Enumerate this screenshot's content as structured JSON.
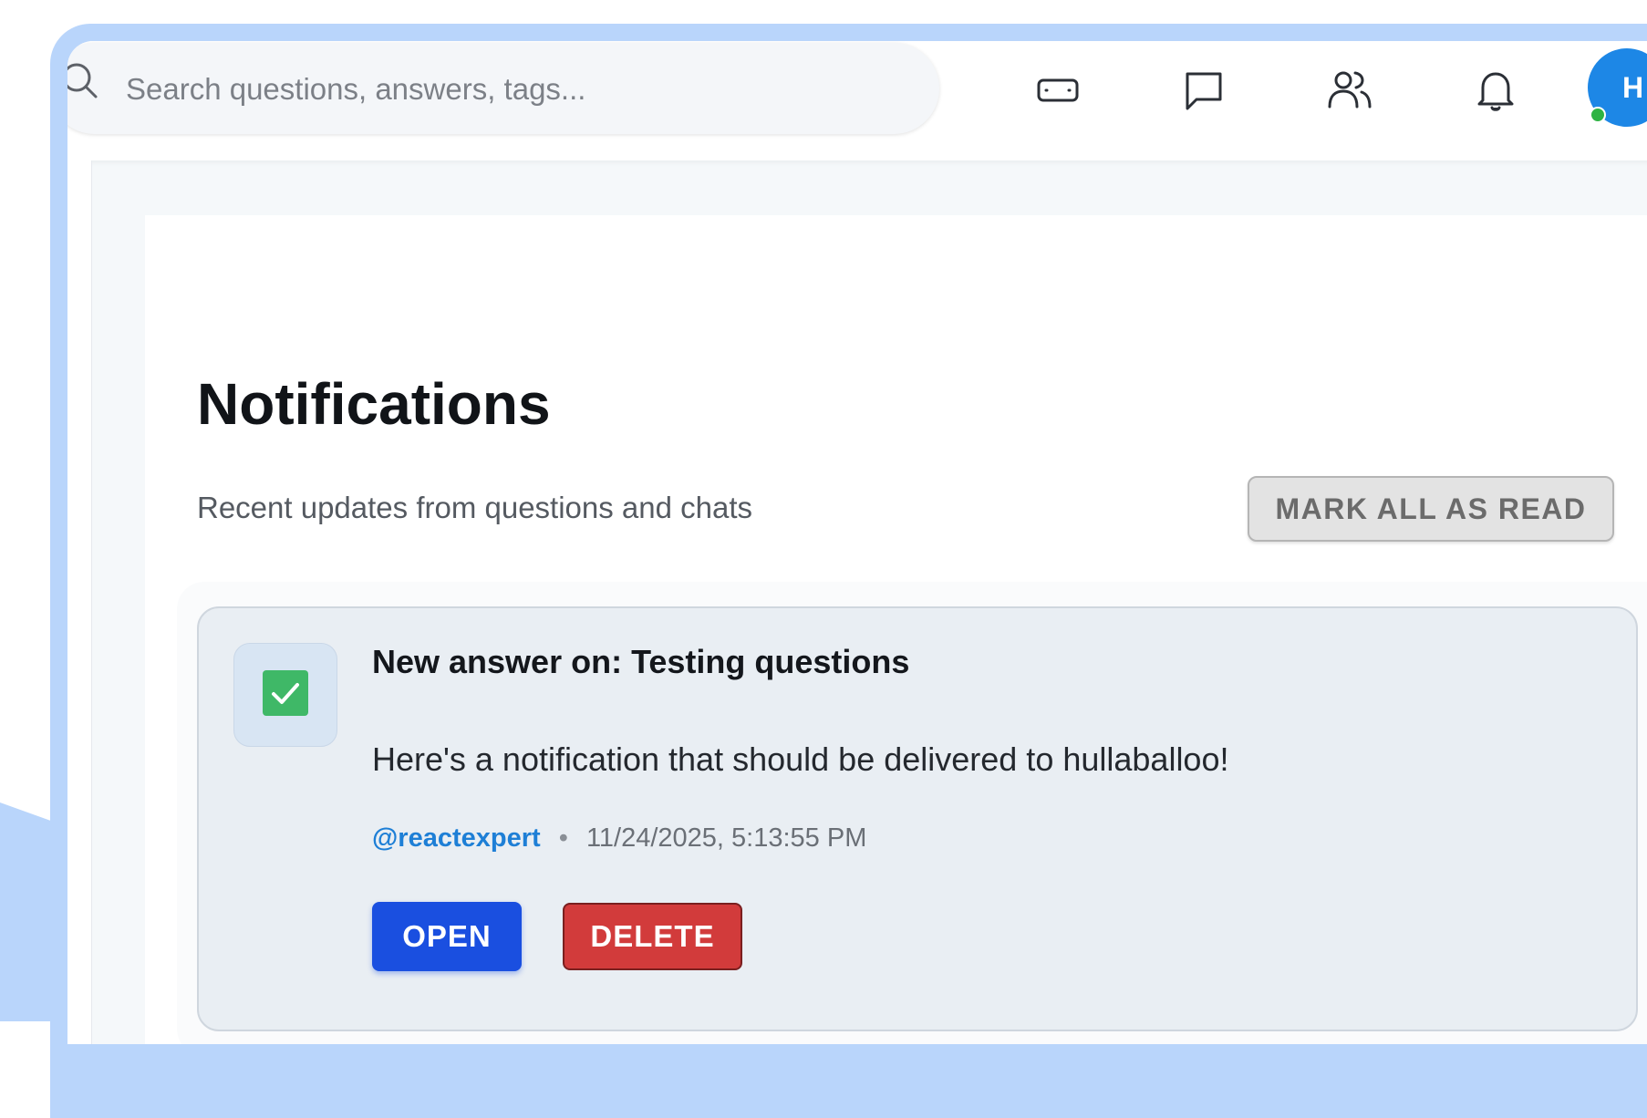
{
  "search": {
    "placeholder": "Search questions, answers, tags..."
  },
  "nav": {
    "icons": [
      "keyboard-icon",
      "chat-icon",
      "users-icon",
      "bell-icon"
    ],
    "avatar_initial": "H",
    "avatar_status": "online"
  },
  "page": {
    "title": "Notifications",
    "subtitle": "Recent updates from questions and chats",
    "mark_all_label": "MARK ALL AS READ"
  },
  "notifications": [
    {
      "icon": "check-icon",
      "title": "New answer on: Testing questions",
      "body": "Here's a notification that should be delivered to hullaballoo!",
      "author": "@reactexpert",
      "separator": "•",
      "timestamp": "11/24/2025, 5:13:55 PM",
      "open_label": "OPEN",
      "delete_label": "DELETE"
    }
  ],
  "colors": {
    "frame": "#b9d5fb",
    "primary": "#1a4fe0",
    "danger": "#d23b3b",
    "link": "#1e7fd6",
    "avatar": "#1d87e6",
    "status_online": "#2fb344",
    "check_green": "#3fb867"
  }
}
